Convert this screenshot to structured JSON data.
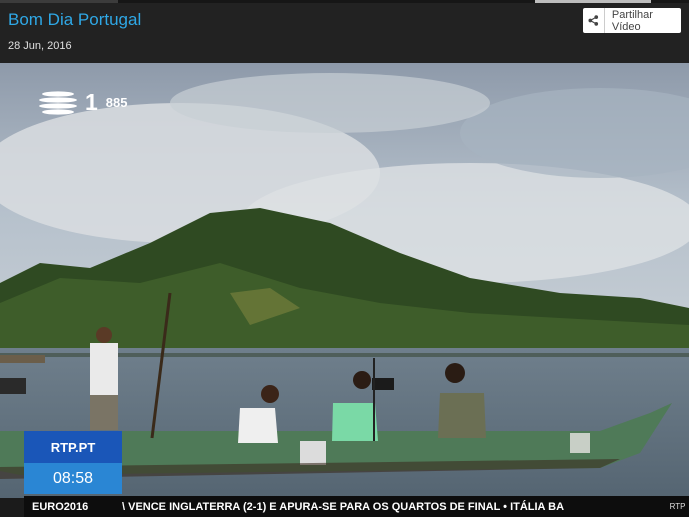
{
  "header": {
    "title": "Bom Dia Portugal",
    "date": "28 Jun, 2016",
    "share_label": "Partilhar Vídeo"
  },
  "video": {
    "channel_number": "1",
    "channel_code": "885",
    "brand_label": "RTP.PT",
    "clock": "08:58",
    "ticker_tag": "EURO2016",
    "ticker_text": "\\ VENCE INGLATERRA (2-1) E APURA-SE PARA OS QUARTOS DE FINAL  •  ITÁLIA BA",
    "side_tag": "RTP"
  },
  "colors": {
    "title": "#2fa8e6",
    "topbar": "#222222",
    "brand_box": "#1a56b8",
    "clock_box": "#2a86d4"
  }
}
